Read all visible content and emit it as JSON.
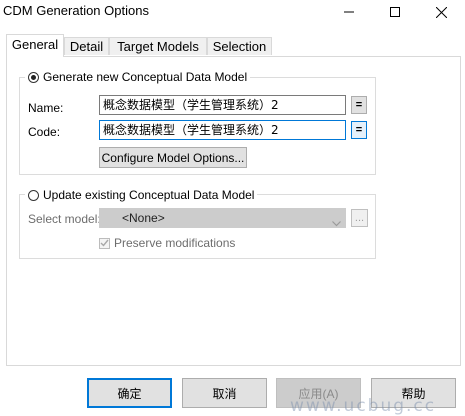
{
  "window": {
    "title": "CDM Generation Options",
    "minimize_icon": "minimize-icon",
    "maximize_icon": "maximize-icon",
    "close_icon": "close-icon"
  },
  "tabs": [
    {
      "label": "General",
      "active": true
    },
    {
      "label": "Detail",
      "active": false
    },
    {
      "label": "Target Models",
      "active": false
    },
    {
      "label": "Selection",
      "active": false
    }
  ],
  "general": {
    "generate_new": {
      "label": "Generate new Conceptual Data Model",
      "selected": true,
      "name_label": "Name:",
      "name_value": "概念数据模型（学生管理系统）2",
      "code_label": "Code:",
      "code_value": "概念数据模型（学生管理系统）2",
      "equal_button": "=",
      "configure_button": "Configure Model Options..."
    },
    "update_existing": {
      "label": "Update existing Conceptual Data Model",
      "selected": false,
      "select_model_label": "Select model:",
      "select_model_value": "<None>",
      "browse_button": "...",
      "preserve_label": "Preserve modifications",
      "preserve_checked": true
    }
  },
  "footer": {
    "ok": "确定",
    "cancel": "取消",
    "apply": "应用(A)",
    "help": "帮助"
  },
  "watermark": "www.ucbug.cc",
  "colors": {
    "focus_border": "#0078d7",
    "disabled_fill": "#cccccc"
  }
}
